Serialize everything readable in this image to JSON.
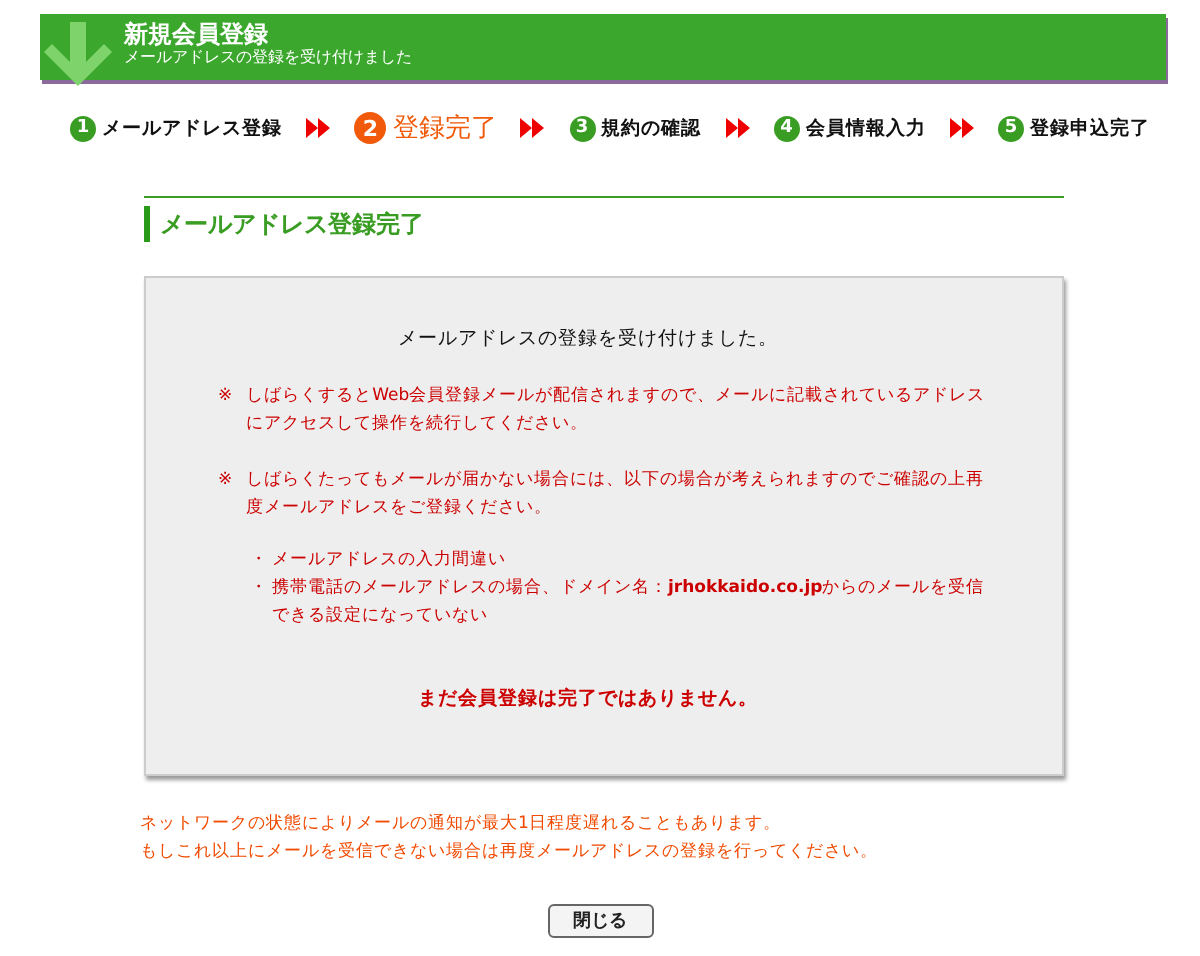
{
  "header": {
    "title": "新規会員登録",
    "subtitle": "メールアドレスの登録を受け付けました"
  },
  "steps": [
    {
      "number": "1",
      "label": "メールアドレス登録",
      "selected": false
    },
    {
      "number": "2",
      "label": "登録完了",
      "selected": true
    },
    {
      "number": "3",
      "label": "規約の確認",
      "selected": false
    },
    {
      "number": "4",
      "label": "会員情報入力",
      "selected": false
    },
    {
      "number": "5",
      "label": "登録申込完了",
      "selected": false
    }
  ],
  "section_title": "メールアドレス登録完了",
  "notice": {
    "heading": "メールアドレスの登録を受け付けました。",
    "notes": [
      {
        "mark": "※",
        "text": "しばらくするとWeb会員登録メールが配信されますので、メールに記載されているアドレスにアクセスして操作を続行してください。"
      },
      {
        "mark": "※",
        "text": "しばらくたってもメールが届かない場合には、以下の場合が考えられますのでご確認の上再度メールアドレスをご登録ください。"
      }
    ],
    "bullets": [
      {
        "mark": "・",
        "text": "メールアドレスの入力間違い"
      },
      {
        "mark": "・",
        "text": "携帯電話のメールアドレスの場合、ドメイン名：**jrhokkaido.co.jp**からのメールを受信できる設定になっていない"
      }
    ],
    "warning": "まだ会員登録は完了ではありません。"
  },
  "footer_notes": [
    "ネットワークの状態によりメールの通知が最大1日程度遅れることもあります。",
    "もしこれ以上にメールを受信できない場合は再度メールアドレスの登録を行ってください。"
  ],
  "close_button": "閉じる"
}
